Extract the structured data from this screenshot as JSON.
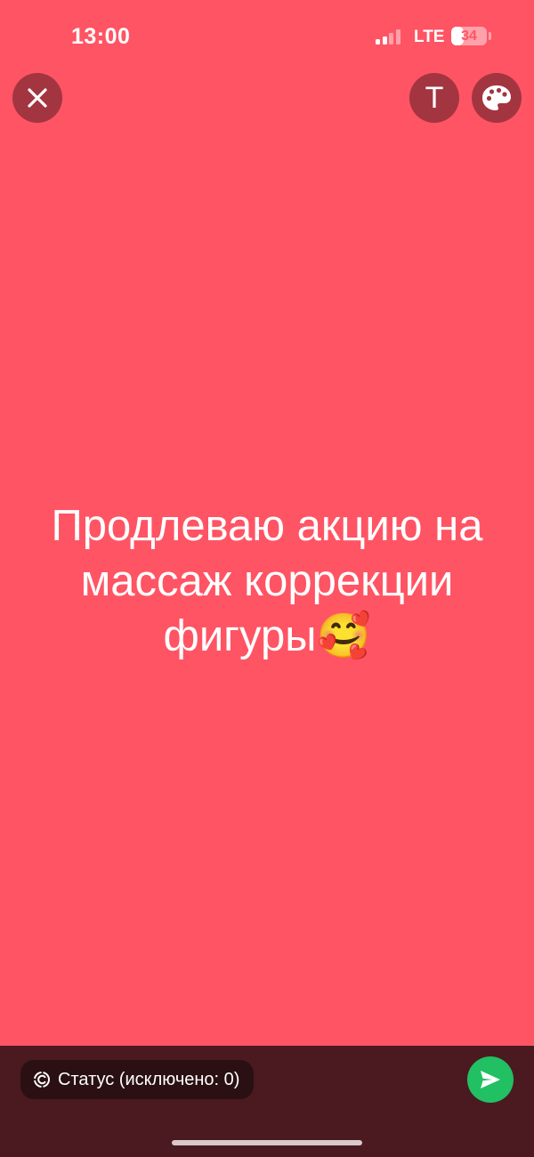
{
  "status_bar": {
    "time": "13:00",
    "signal_bars_active": 2,
    "signal_bars_total": 4,
    "network": "LTE",
    "battery_level": "34",
    "battery_fraction": 0.34
  },
  "toolbar": {
    "close_icon": "close-icon",
    "text_button_glyph": "T",
    "palette_icon": "palette-icon"
  },
  "status_editor": {
    "background_color": "#FF5464",
    "text": "Продлеваю акцию на массаж коррекции фигуры🥰"
  },
  "footer": {
    "audience_icon": "status-ring-icon",
    "audience_label": "Статус (исключено: 0)",
    "send_icon": "send-icon",
    "send_color": "#21C063"
  }
}
